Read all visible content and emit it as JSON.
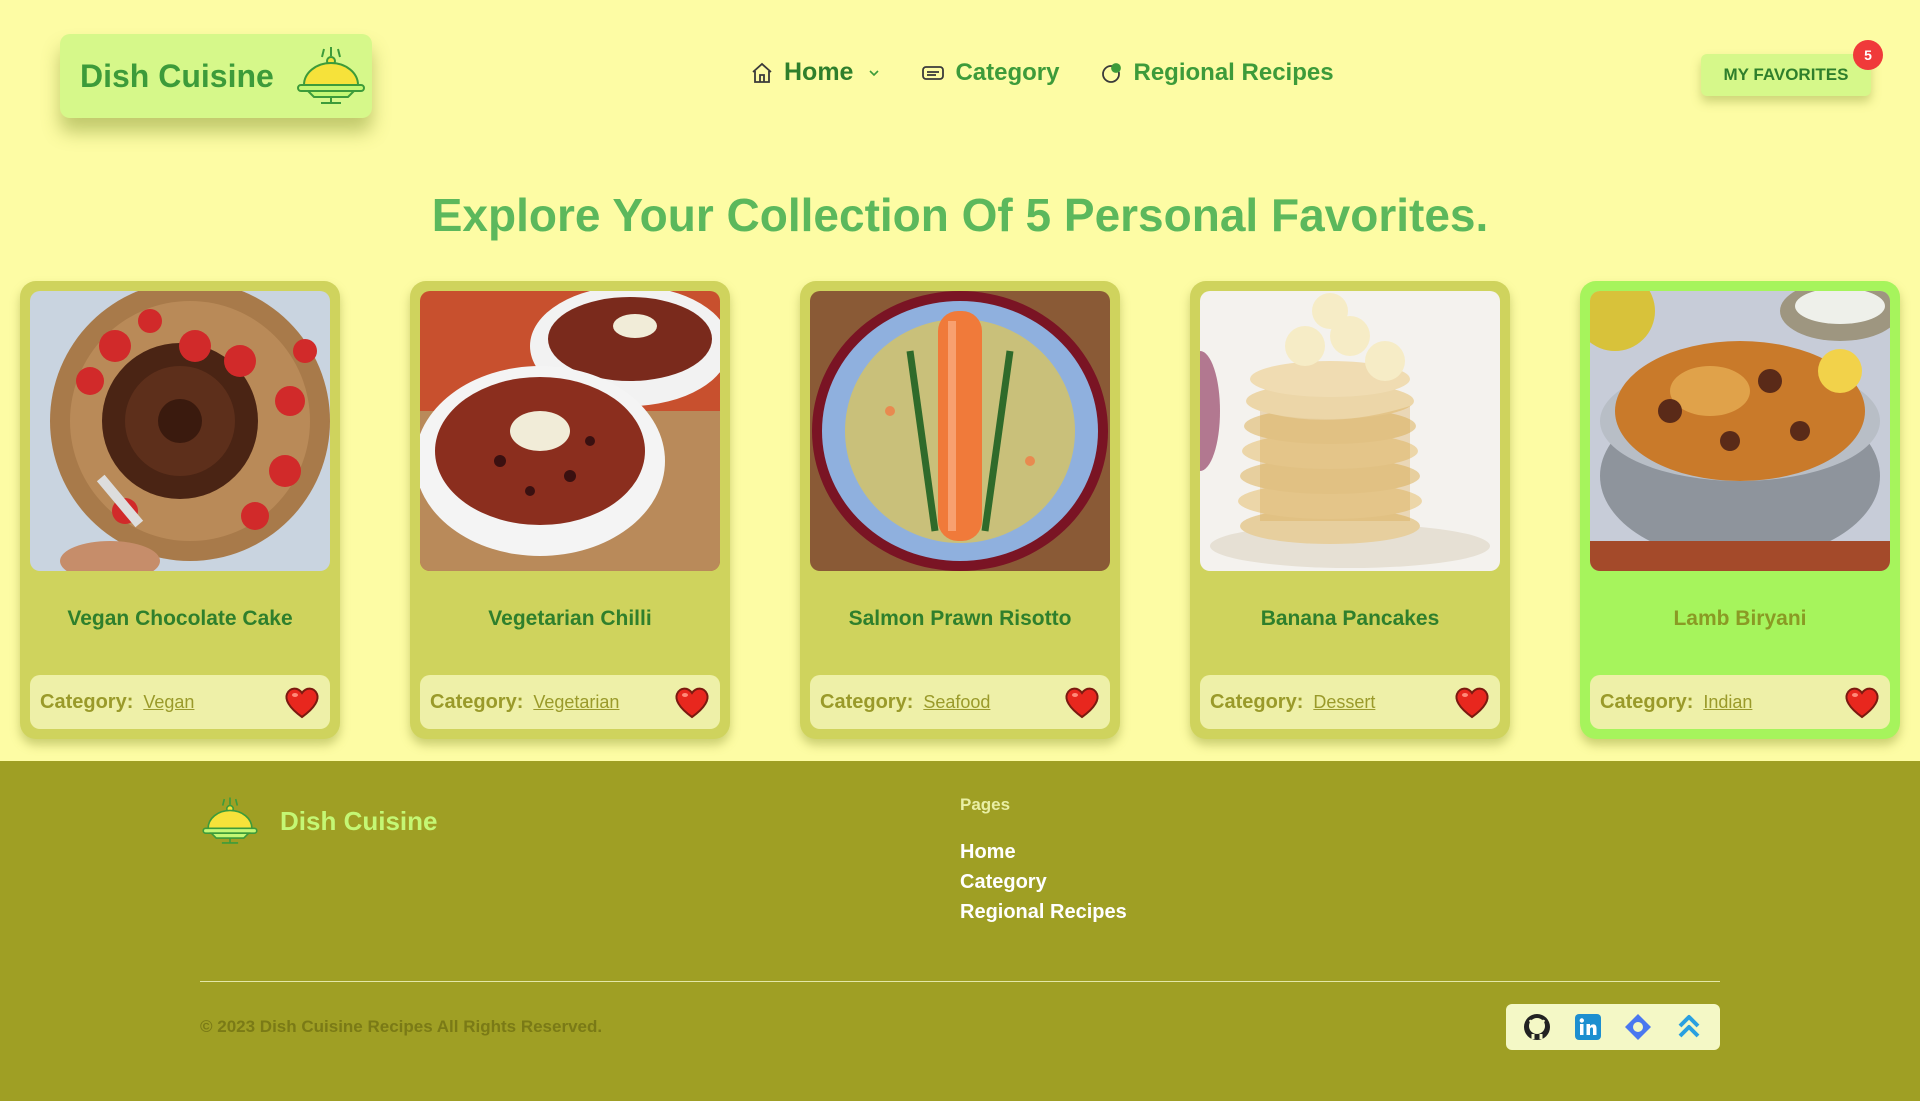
{
  "header": {
    "brand": "Dish Cuisine",
    "nav": [
      {
        "label": "Home",
        "icon": "home-icon",
        "has_dropdown": true
      },
      {
        "label": "Category",
        "icon": "category-icon"
      },
      {
        "label": "Regional Recipes",
        "icon": "region-icon"
      }
    ],
    "favorites_label": "MY FAVORITES",
    "favorites_count": "5"
  },
  "main": {
    "title": "Explore Your Collection Of 5 Personal Favorites.",
    "cards": [
      {
        "title": "Vegan Chocolate Cake",
        "category_label": "Category:",
        "category": "Vegan",
        "favorited": true
      },
      {
        "title": "Vegetarian Chilli",
        "category_label": "Category:",
        "category": "Vegetarian",
        "favorited": true
      },
      {
        "title": "Salmon Prawn Risotto",
        "category_label": "Category:",
        "category": "Seafood",
        "favorited": true
      },
      {
        "title": "Banana Pancakes",
        "category_label": "Category:",
        "category": "Dessert",
        "favorited": true
      },
      {
        "title": "Lamb Biryani",
        "category_label": "Category:",
        "category": "Indian",
        "favorited": true
      }
    ]
  },
  "footer": {
    "brand": "Dish Cuisine",
    "pages_title": "Pages",
    "links": [
      "Home",
      "Category",
      "Regional Recipes"
    ],
    "copyright": "© 2023 Dish Cuisine Recipes All Rights Reserved.",
    "social": [
      "github-icon",
      "linkedin-icon",
      "portfolio-icon",
      "scroll-top-icon"
    ]
  },
  "colors": {
    "background": "#fdfca4",
    "brand_green": "#3d9b3a",
    "card": "#cfd35d",
    "card_active": "#a6f45c",
    "footer": "#9f9f24",
    "heart": "#e8271e",
    "badge": "#f03a3a"
  }
}
